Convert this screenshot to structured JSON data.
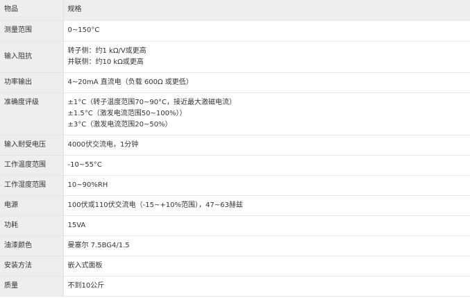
{
  "table": {
    "header": {
      "label": "物品",
      "value": "规格"
    },
    "rows": [
      {
        "label": "测量范围",
        "lines": [
          "0~150°C"
        ]
      },
      {
        "label": "输入阻抗",
        "lines": [
          "转子侧：约1 kΩ/V或更高",
          "并联侧：约10 kΩ或更高"
        ]
      },
      {
        "label": "功率输出",
        "lines": [
          "4~20mA 直流电（负载 600Ω 或更低）"
        ]
      },
      {
        "label": "准确度评级",
        "lines": [
          "±1°C（转子温度范围70~90°C，接近最大激磁电流）",
          "±1.5°C（激发电流范围50~100%））",
          "±3°C（激发电流范围20~50%）"
        ]
      },
      {
        "label": "输入耐受电压",
        "lines": [
          "4000伏交流电，1分钟"
        ]
      },
      {
        "label": "工作温度范围",
        "lines": [
          "-10~55°C"
        ]
      },
      {
        "label": "工作湿度范围",
        "lines": [
          "10~90%RH"
        ]
      },
      {
        "label": "电源",
        "lines": [
          "100伏或110伏交流电（-15~+10%范围），47~63赫兹"
        ]
      },
      {
        "label": "功耗",
        "lines": [
          "15VA"
        ]
      },
      {
        "label": "油漆颜色",
        "lines": [
          "曼塞尔 7.5BG4/1.5"
        ]
      },
      {
        "label": "安装方法",
        "lines": [
          "嵌入式面板"
        ]
      },
      {
        "label": "质量",
        "lines": [
          "不到10公斤"
        ]
      }
    ]
  }
}
